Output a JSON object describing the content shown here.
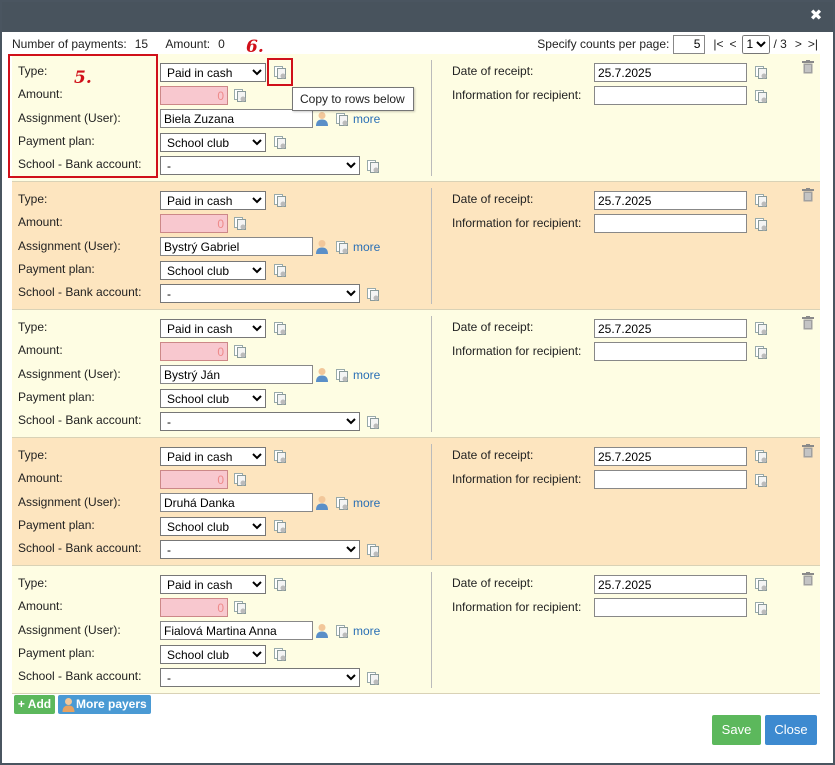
{
  "header": {
    "close_symbol": "✖",
    "num_payments_label": "Number of payments:",
    "num_payments": "15",
    "amount_label": "Amount:",
    "amount": "0"
  },
  "pager": {
    "label": "Specify counts per page:",
    "per_page": "5",
    "first": "|<",
    "prev": "<",
    "current_page": "1",
    "total": "/ 3",
    "next": ">",
    "last": ">|"
  },
  "labels": {
    "type": "Type:",
    "amount": "Amount:",
    "assignment": "Assignment (User):",
    "payment_plan": "Payment plan:",
    "bank_account": "School - Bank account:",
    "date_of_receipt": "Date of receipt:",
    "info_recipient": "Information for recipient:",
    "more": "more"
  },
  "payments": [
    {
      "type": "Paid in cash",
      "amount": "0",
      "user": "Biela Zuzana",
      "plan": "School club",
      "bank": "-",
      "date": "25.7.2025",
      "info": ""
    },
    {
      "type": "Paid in cash",
      "amount": "0",
      "user": "Bystrý Gabriel",
      "plan": "School club",
      "bank": "-",
      "date": "25.7.2025",
      "info": ""
    },
    {
      "type": "Paid in cash",
      "amount": "0",
      "user": "Bystrý Ján",
      "plan": "School club",
      "bank": "-",
      "date": "25.7.2025",
      "info": ""
    },
    {
      "type": "Paid in cash",
      "amount": "0",
      "user": "Druhá Danka",
      "plan": "School club",
      "bank": "-",
      "date": "25.7.2025",
      "info": ""
    },
    {
      "type": "Paid in cash",
      "amount": "0",
      "user": "Fialová Martina Anna",
      "plan": "School club",
      "bank": "-",
      "date": "25.7.2025",
      "info": ""
    }
  ],
  "annotations": {
    "box5": "5.",
    "box6": "6.",
    "tooltip": "Copy to rows below"
  },
  "footer": {
    "add": "+ Add",
    "more_payers": "More payers",
    "save": "Save",
    "close": "Close"
  },
  "colors": {
    "titlebar": "#48535d",
    "row_light": "#fefde3",
    "row_dark": "#fde5bf",
    "amount_bg": "#f8c8cf",
    "annotation_red": "#d0101a",
    "save_green": "#5cb85c",
    "close_blue": "#3d8ad0"
  }
}
